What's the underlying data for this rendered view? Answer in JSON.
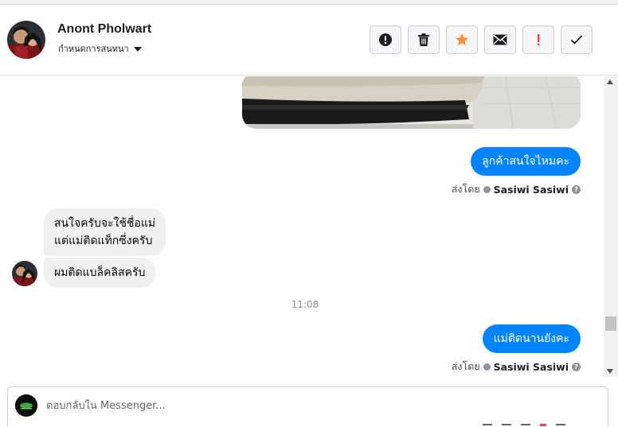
{
  "header": {
    "contact_name": "Anont Pholwart",
    "assign_label": "กำหนดการสนทนา"
  },
  "actions": [
    {
      "icon": "alert-circle-icon",
      "name": "mark-spam-button"
    },
    {
      "icon": "trash-icon",
      "name": "delete-button"
    },
    {
      "icon": "star-icon",
      "name": "star-button"
    },
    {
      "icon": "envelope-icon",
      "name": "mark-unread-button"
    },
    {
      "icon": "exclamation-icon",
      "name": "follow-up-button"
    },
    {
      "icon": "check-icon",
      "name": "mark-done-button"
    }
  ],
  "colors": {
    "accent": "#0084ff",
    "star": "#f7923b",
    "follow_up": "#fa383e"
  },
  "messages": {
    "out1": "ลูกค้าสนใจไหมคะ",
    "sent_by_label": "ส่งโดย",
    "sender": "Sasiwi Sasiwi",
    "in1_line1": "สนใจครับจะใช้ชื่อแม่",
    "in1_line2": "แต่แม่ติดแท็กซี่งครับ",
    "in2": "ผมติดแบล็คลิสครับ",
    "time": "11:08",
    "out2": "แม่ติดนานยังคะ"
  },
  "composer": {
    "placeholder": "ตอบกลับใน Messenger..."
  }
}
